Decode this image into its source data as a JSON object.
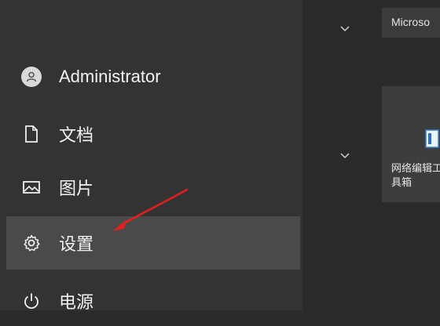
{
  "start_menu": {
    "user": {
      "label": "Administrator",
      "icon": "user-icon"
    },
    "items": [
      {
        "label": "文档",
        "icon": "document-icon"
      },
      {
        "label": "图片",
        "icon": "picture-icon"
      },
      {
        "label": "设置",
        "icon": "gear-icon",
        "highlighted": true
      },
      {
        "label": "电源",
        "icon": "power-icon"
      }
    ]
  },
  "tiles": {
    "group_top": {
      "label": "Microso"
    },
    "group_mid": {
      "label": "网络编辑工具箱"
    }
  },
  "annotation": {
    "icon": "red-arrow",
    "color": "#e02020"
  },
  "colors": {
    "sidebar": "#333333",
    "highlight": "#4a4a4a",
    "tile": "#3d3d3d"
  }
}
